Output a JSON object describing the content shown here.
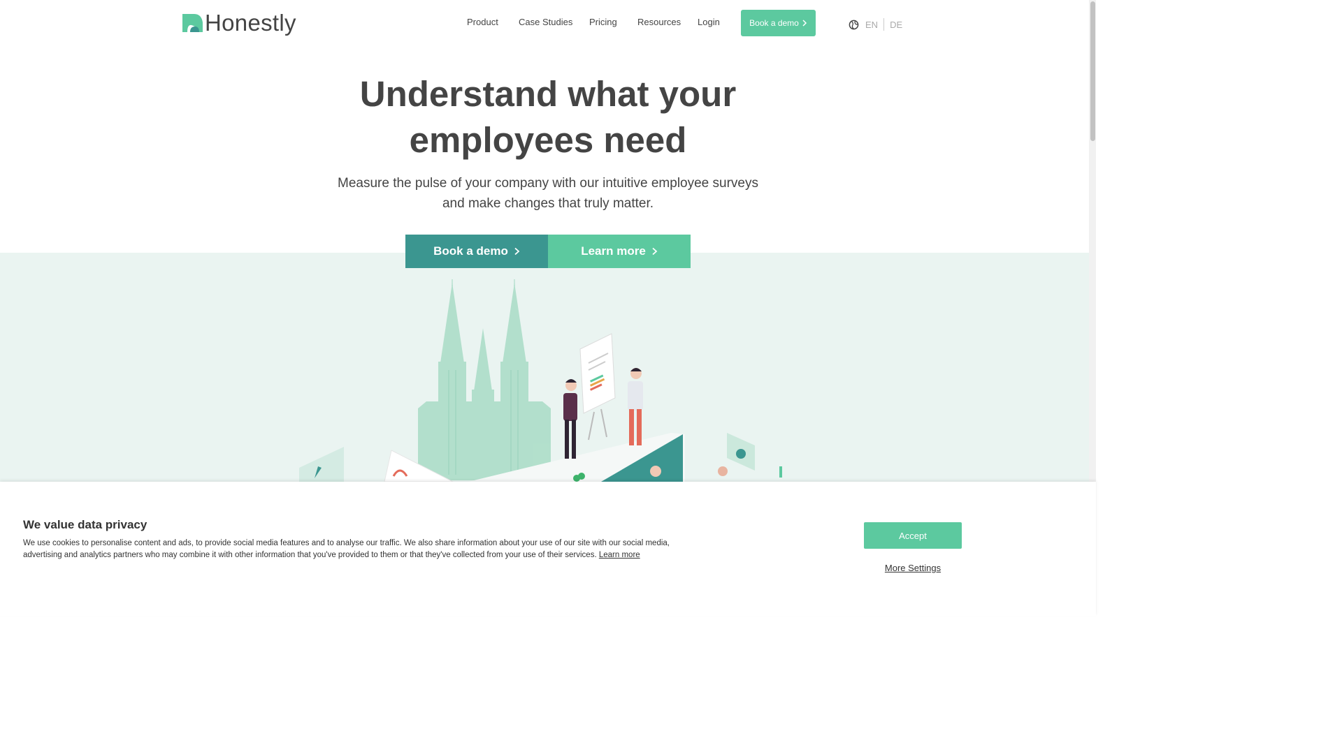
{
  "brand": {
    "name": "Honestly",
    "color_primary": "#5cc99f",
    "color_dark": "#3b9690"
  },
  "nav": {
    "items": [
      "Product",
      "Case Studies",
      "Pricing",
      "Resources",
      "Login"
    ],
    "cta_label": "Book a demo",
    "languages": [
      "EN",
      "DE"
    ]
  },
  "hero": {
    "title_line1": "Understand what your",
    "title_line2": "employees need",
    "subtitle_line1": "Measure the pulse of your company with our intuitive employee surveys",
    "subtitle_line2": "and make changes that truly matter.",
    "primary_cta": "Book a demo",
    "secondary_cta": "Learn more"
  },
  "cookie_banner": {
    "title": "We value data privacy",
    "text": "We use cookies to personalise content and ads, to provide social media features and to analyse our traffic. We also share information about your use of our site with our social media, advertising and analytics partners who may combine it with other information that you've provided to them or that they've collected from your use of their services.",
    "learn_more": "Learn more",
    "accept_label": "Accept",
    "more_settings_label": "More Settings"
  },
  "icons": {
    "logo": "honestly-logo-icon",
    "chevron": "chevron-right-icon",
    "globe": "globe-icon"
  }
}
